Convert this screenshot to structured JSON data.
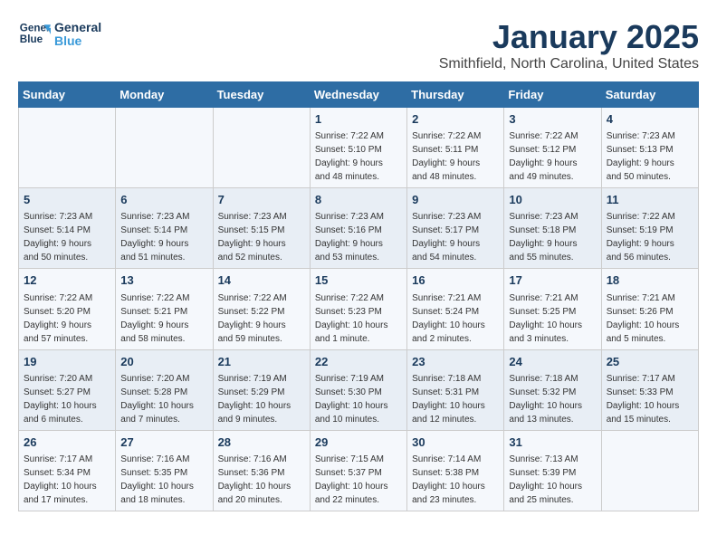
{
  "header": {
    "logo_line1": "General",
    "logo_line2": "Blue",
    "month_title": "January 2025",
    "location": "Smithfield, North Carolina, United States"
  },
  "weekdays": [
    "Sunday",
    "Monday",
    "Tuesday",
    "Wednesday",
    "Thursday",
    "Friday",
    "Saturday"
  ],
  "weeks": [
    [
      {
        "day": "",
        "info": ""
      },
      {
        "day": "",
        "info": ""
      },
      {
        "day": "",
        "info": ""
      },
      {
        "day": "1",
        "info": "Sunrise: 7:22 AM\nSunset: 5:10 PM\nDaylight: 9 hours\nand 48 minutes."
      },
      {
        "day": "2",
        "info": "Sunrise: 7:22 AM\nSunset: 5:11 PM\nDaylight: 9 hours\nand 48 minutes."
      },
      {
        "day": "3",
        "info": "Sunrise: 7:22 AM\nSunset: 5:12 PM\nDaylight: 9 hours\nand 49 minutes."
      },
      {
        "day": "4",
        "info": "Sunrise: 7:23 AM\nSunset: 5:13 PM\nDaylight: 9 hours\nand 50 minutes."
      }
    ],
    [
      {
        "day": "5",
        "info": "Sunrise: 7:23 AM\nSunset: 5:14 PM\nDaylight: 9 hours\nand 50 minutes."
      },
      {
        "day": "6",
        "info": "Sunrise: 7:23 AM\nSunset: 5:14 PM\nDaylight: 9 hours\nand 51 minutes."
      },
      {
        "day": "7",
        "info": "Sunrise: 7:23 AM\nSunset: 5:15 PM\nDaylight: 9 hours\nand 52 minutes."
      },
      {
        "day": "8",
        "info": "Sunrise: 7:23 AM\nSunset: 5:16 PM\nDaylight: 9 hours\nand 53 minutes."
      },
      {
        "day": "9",
        "info": "Sunrise: 7:23 AM\nSunset: 5:17 PM\nDaylight: 9 hours\nand 54 minutes."
      },
      {
        "day": "10",
        "info": "Sunrise: 7:23 AM\nSunset: 5:18 PM\nDaylight: 9 hours\nand 55 minutes."
      },
      {
        "day": "11",
        "info": "Sunrise: 7:22 AM\nSunset: 5:19 PM\nDaylight: 9 hours\nand 56 minutes."
      }
    ],
    [
      {
        "day": "12",
        "info": "Sunrise: 7:22 AM\nSunset: 5:20 PM\nDaylight: 9 hours\nand 57 minutes."
      },
      {
        "day": "13",
        "info": "Sunrise: 7:22 AM\nSunset: 5:21 PM\nDaylight: 9 hours\nand 58 minutes."
      },
      {
        "day": "14",
        "info": "Sunrise: 7:22 AM\nSunset: 5:22 PM\nDaylight: 9 hours\nand 59 minutes."
      },
      {
        "day": "15",
        "info": "Sunrise: 7:22 AM\nSunset: 5:23 PM\nDaylight: 10 hours\nand 1 minute."
      },
      {
        "day": "16",
        "info": "Sunrise: 7:21 AM\nSunset: 5:24 PM\nDaylight: 10 hours\nand 2 minutes."
      },
      {
        "day": "17",
        "info": "Sunrise: 7:21 AM\nSunset: 5:25 PM\nDaylight: 10 hours\nand 3 minutes."
      },
      {
        "day": "18",
        "info": "Sunrise: 7:21 AM\nSunset: 5:26 PM\nDaylight: 10 hours\nand 5 minutes."
      }
    ],
    [
      {
        "day": "19",
        "info": "Sunrise: 7:20 AM\nSunset: 5:27 PM\nDaylight: 10 hours\nand 6 minutes."
      },
      {
        "day": "20",
        "info": "Sunrise: 7:20 AM\nSunset: 5:28 PM\nDaylight: 10 hours\nand 7 minutes."
      },
      {
        "day": "21",
        "info": "Sunrise: 7:19 AM\nSunset: 5:29 PM\nDaylight: 10 hours\nand 9 minutes."
      },
      {
        "day": "22",
        "info": "Sunrise: 7:19 AM\nSunset: 5:30 PM\nDaylight: 10 hours\nand 10 minutes."
      },
      {
        "day": "23",
        "info": "Sunrise: 7:18 AM\nSunset: 5:31 PM\nDaylight: 10 hours\nand 12 minutes."
      },
      {
        "day": "24",
        "info": "Sunrise: 7:18 AM\nSunset: 5:32 PM\nDaylight: 10 hours\nand 13 minutes."
      },
      {
        "day": "25",
        "info": "Sunrise: 7:17 AM\nSunset: 5:33 PM\nDaylight: 10 hours\nand 15 minutes."
      }
    ],
    [
      {
        "day": "26",
        "info": "Sunrise: 7:17 AM\nSunset: 5:34 PM\nDaylight: 10 hours\nand 17 minutes."
      },
      {
        "day": "27",
        "info": "Sunrise: 7:16 AM\nSunset: 5:35 PM\nDaylight: 10 hours\nand 18 minutes."
      },
      {
        "day": "28",
        "info": "Sunrise: 7:16 AM\nSunset: 5:36 PM\nDaylight: 10 hours\nand 20 minutes."
      },
      {
        "day": "29",
        "info": "Sunrise: 7:15 AM\nSunset: 5:37 PM\nDaylight: 10 hours\nand 22 minutes."
      },
      {
        "day": "30",
        "info": "Sunrise: 7:14 AM\nSunset: 5:38 PM\nDaylight: 10 hours\nand 23 minutes."
      },
      {
        "day": "31",
        "info": "Sunrise: 7:13 AM\nSunset: 5:39 PM\nDaylight: 10 hours\nand 25 minutes."
      },
      {
        "day": "",
        "info": ""
      }
    ]
  ]
}
